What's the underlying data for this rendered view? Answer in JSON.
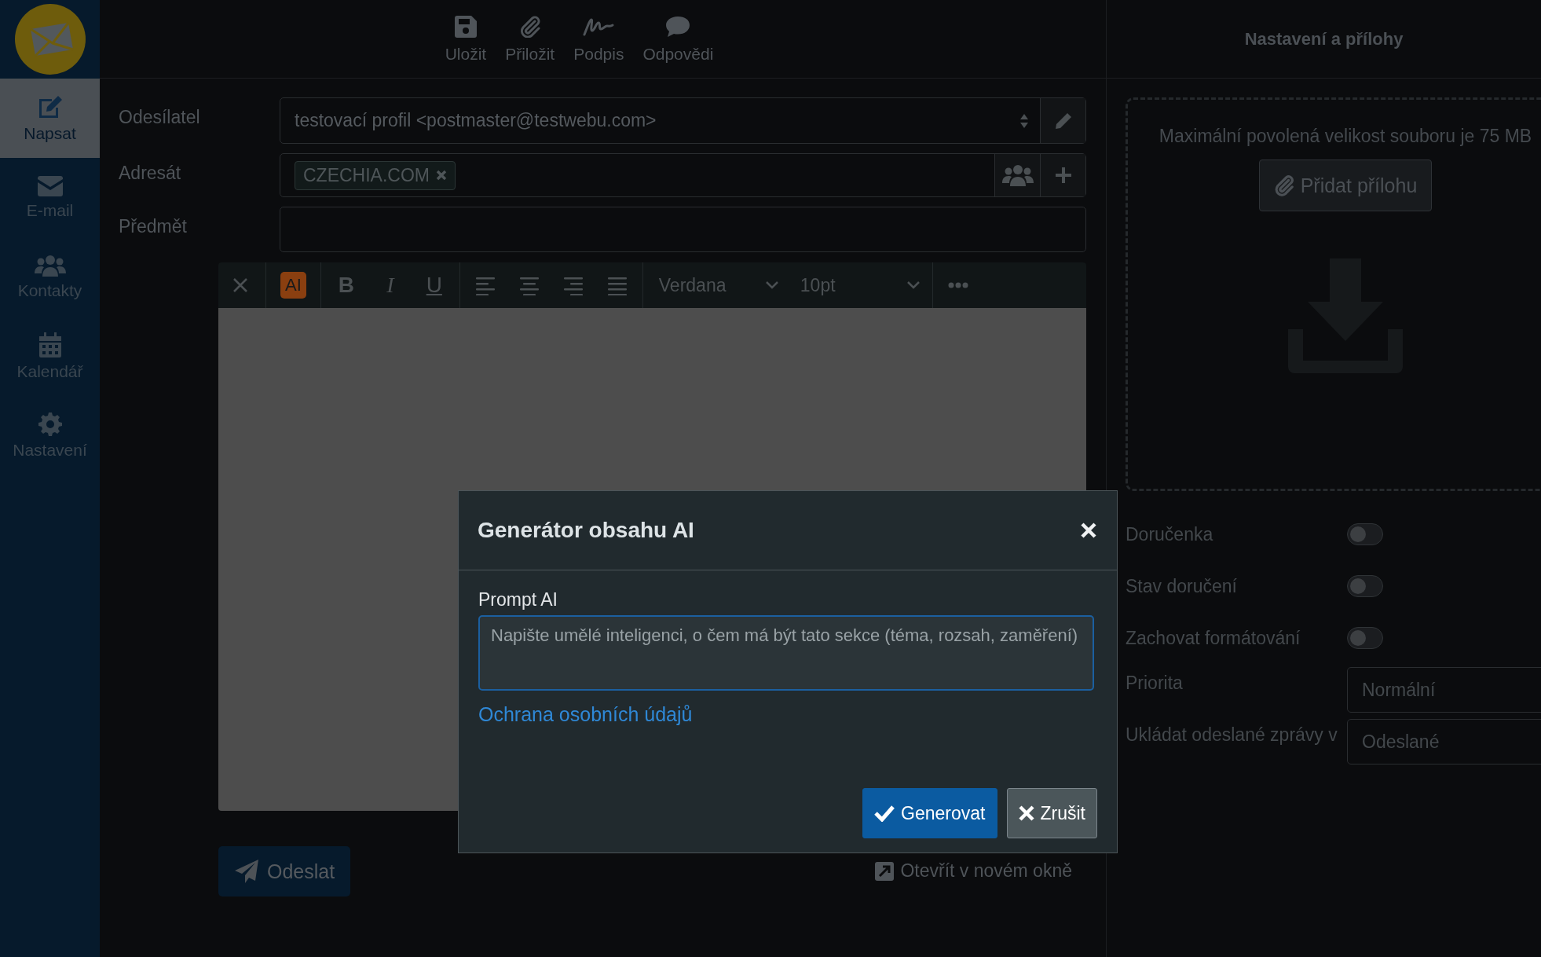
{
  "sidebar": {
    "items": [
      {
        "label": "Napsat",
        "selected": true
      },
      {
        "label": "E-mail",
        "selected": false
      },
      {
        "label": "Kontakty",
        "selected": false
      },
      {
        "label": "Kalendář",
        "selected": false
      },
      {
        "label": "Nastavení",
        "selected": false
      }
    ]
  },
  "toolbar": {
    "buttons": [
      {
        "label": "Uložit"
      },
      {
        "label": "Přiložit"
      },
      {
        "label": "Podpis"
      },
      {
        "label": "Odpovědi"
      }
    ]
  },
  "form": {
    "sender": {
      "label": "Odesílatel",
      "value": "testovací profil <postmaster@testwebu.com>"
    },
    "recipient": {
      "label": "Adresát",
      "tags": [
        "CZECHIA.COM"
      ]
    },
    "subject": {
      "label": "Předmět"
    }
  },
  "editor": {
    "ai_button": "AI",
    "format_buttons": [
      "B",
      "I",
      "U"
    ],
    "font": "Verdana",
    "size": "10pt"
  },
  "send_button": "Odeslat",
  "open_in_new_window": "Otevřít v novém okně",
  "settings_panel": {
    "title": "Nastavení a přílohy",
    "dropzone": {
      "text": "Maximální povolená velikost souboru je 75 MB",
      "button": "Přidat přílohu"
    },
    "toggles": [
      {
        "label": "Doručenka",
        "on": false
      },
      {
        "label": "Stav doručení",
        "on": false
      },
      {
        "label": "Zachovat formátování",
        "on": false
      }
    ],
    "selects": [
      {
        "label": "Priorita",
        "value": "Normální"
      },
      {
        "label": "Ukládat odeslané zprávy v",
        "value": "Odeslané"
      }
    ]
  },
  "dialog": {
    "title": "Generátor obsahu AI",
    "field_label": "Prompt AI",
    "placeholder": "Napište umělé inteligenci, o čem má být tato sekce (téma, rozsah, zaměření)",
    "link": "Ochrana osobních údajů",
    "buttons": [
      {
        "label": "Generovat",
        "kind": "primary"
      },
      {
        "label": "Zrušit",
        "kind": "secondary"
      }
    ]
  }
}
